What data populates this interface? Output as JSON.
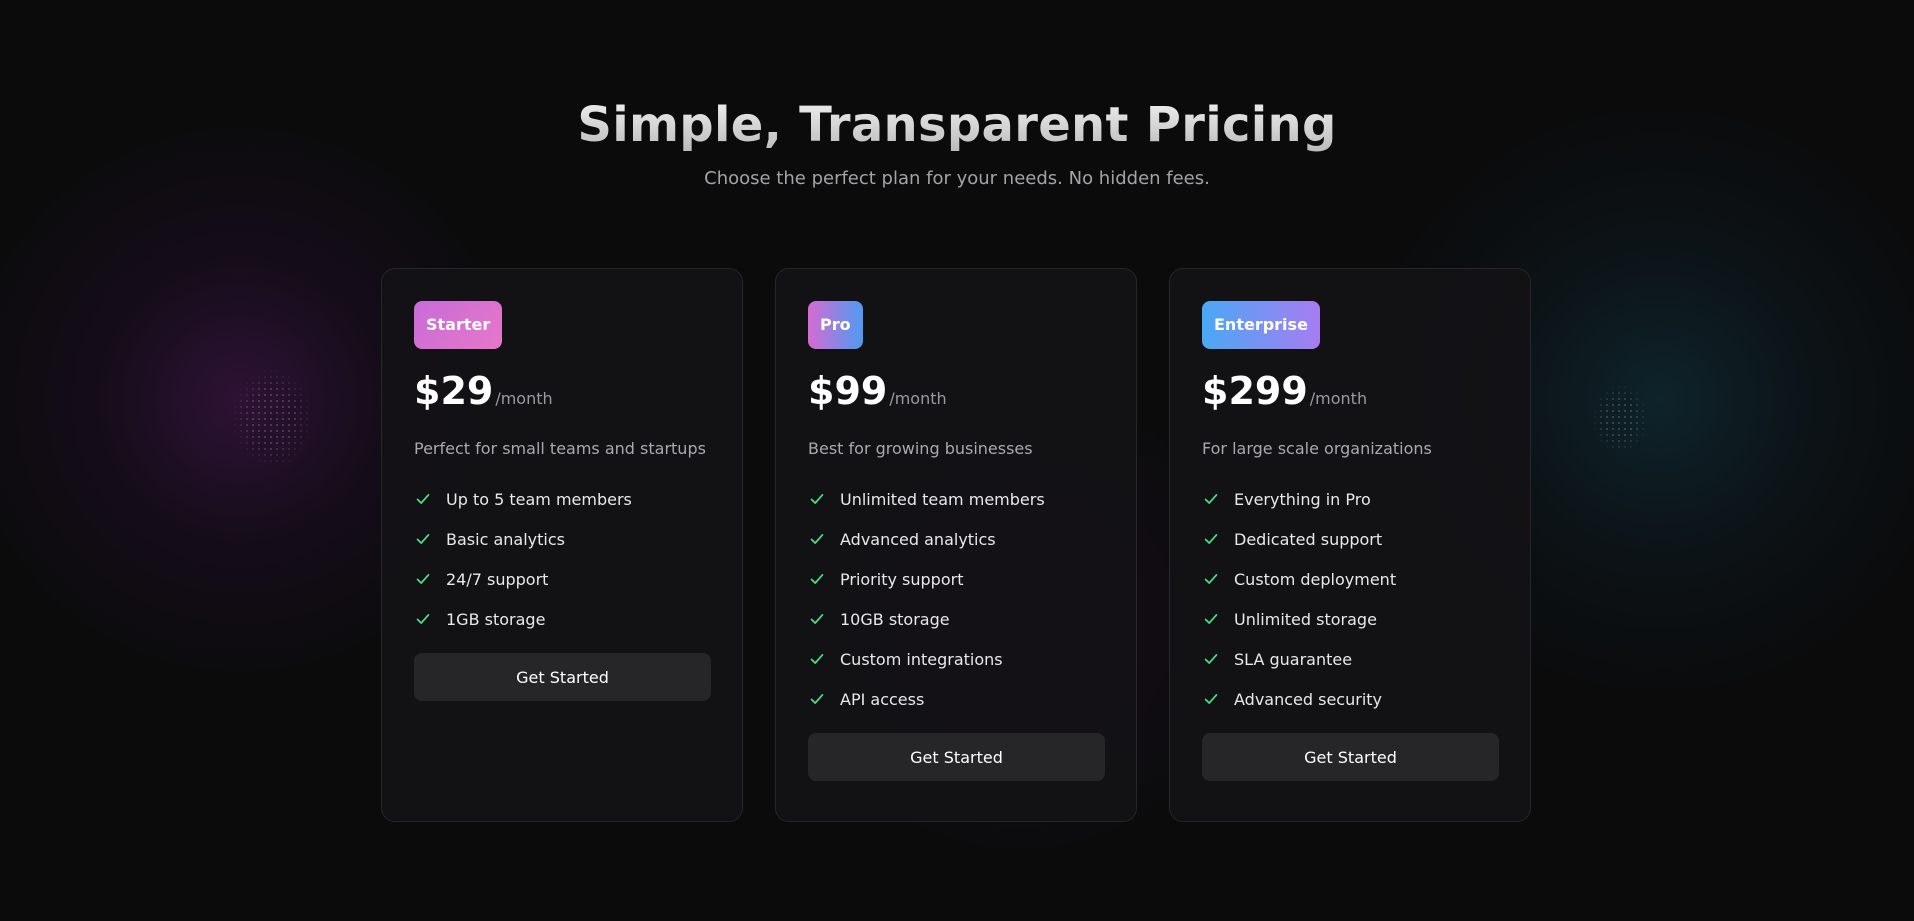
{
  "header": {
    "title": "Simple, Transparent Pricing",
    "subtitle": "Choose the perfect plan for your needs. No hidden fees."
  },
  "plans": [
    {
      "badge": "Starter",
      "price": "$29",
      "period": "/month",
      "description": "Perfect for small teams and startups",
      "features": [
        "Up to 5 team members",
        "Basic analytics",
        "24/7 support",
        "1GB storage"
      ],
      "cta": "Get Started"
    },
    {
      "badge": "Pro",
      "price": "$99",
      "period": "/month",
      "description": "Best for growing businesses",
      "features": [
        "Unlimited team members",
        "Advanced analytics",
        "Priority support",
        "10GB storage",
        "Custom integrations",
        "API access"
      ],
      "cta": "Get Started"
    },
    {
      "badge": "Enterprise",
      "price": "$299",
      "period": "/month",
      "description": "For large scale organizations",
      "features": [
        "Everything in Pro",
        "Dedicated support",
        "Custom deployment",
        "Unlimited storage",
        "SLA guarantee",
        "Advanced security"
      ],
      "cta": "Get Started"
    }
  ],
  "colors": {
    "background": "#0b0b0c",
    "card_border": "#26262b",
    "check": "#4ade80",
    "button": "#262628"
  },
  "icons": {
    "feature": "check-icon"
  }
}
